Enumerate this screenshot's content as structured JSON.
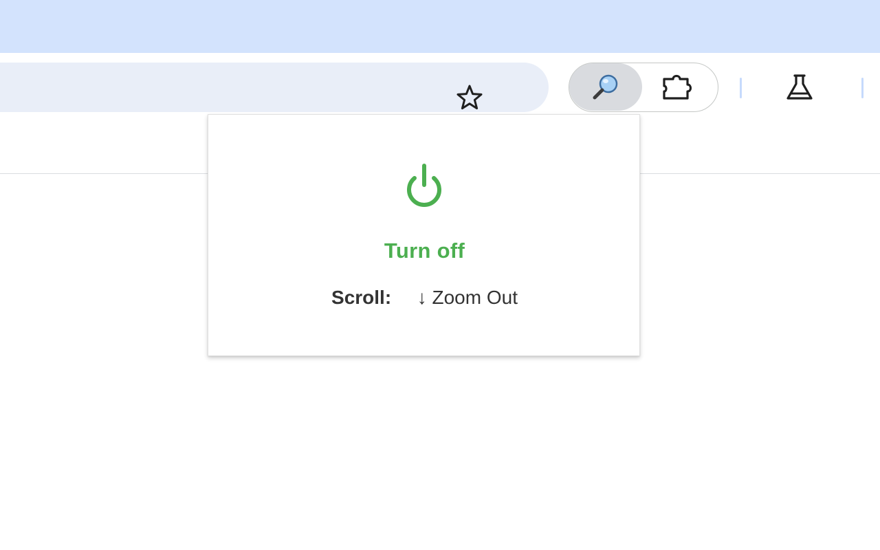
{
  "browser": {
    "titlebar_color": "#d3e3fd",
    "omnibox": {
      "background": "#e9eef8",
      "bookmark_icon": "star-outline-icon"
    },
    "extensions": {
      "zoom_extension_icon": "magnifier-icon",
      "extensions_menu_icon": "puzzle-piece-icon"
    },
    "labs_icon": "flask-icon"
  },
  "popup": {
    "power_icon": "power-icon",
    "accent_color": "#4caf50",
    "action_label": "Turn off",
    "scroll_label": "Scroll:",
    "scroll_arrow": "↓",
    "scroll_action": "Zoom Out"
  }
}
